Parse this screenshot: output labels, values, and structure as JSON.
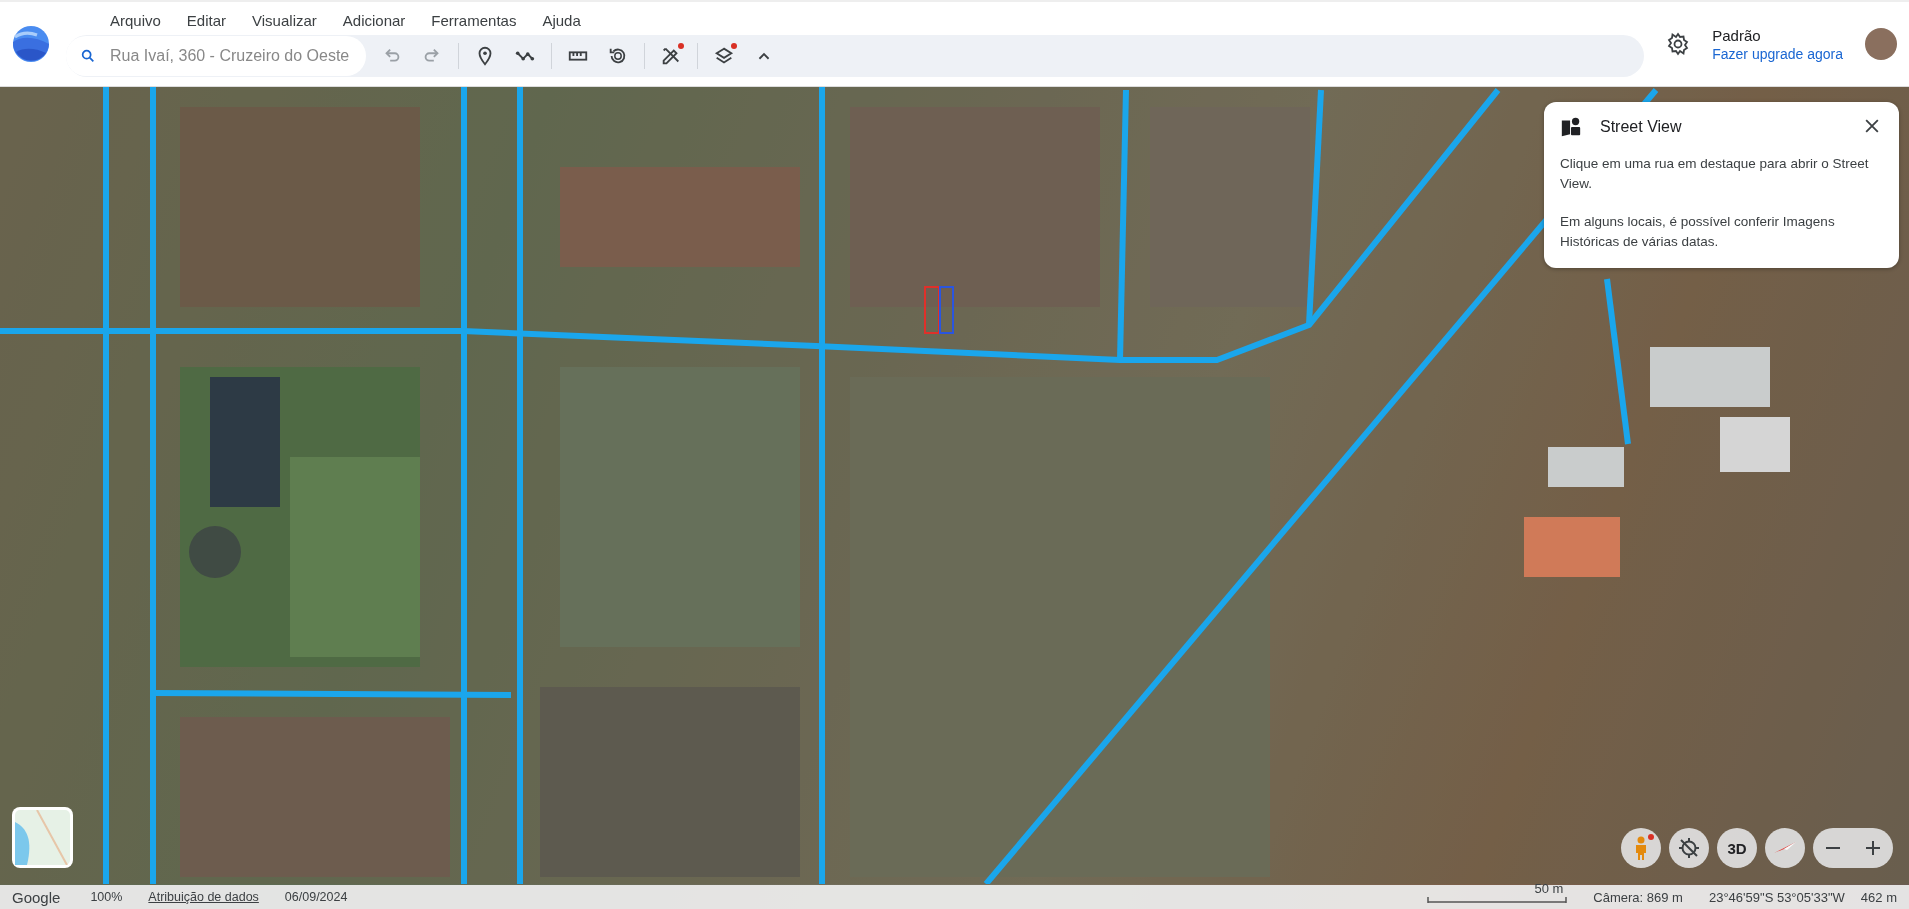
{
  "menu": [
    "Arquivo",
    "Editar",
    "Visualizar",
    "Adicionar",
    "Ferramentas",
    "Ajuda"
  ],
  "search": {
    "placeholder": "Rua Ivaí, 360 - Cruzeiro do Oeste"
  },
  "toolbar_groups": [
    [
      {
        "kind": "undo",
        "disabled": true
      },
      {
        "kind": "redo",
        "disabled": true
      }
    ],
    [
      {
        "kind": "pin",
        "disabled": false
      },
      {
        "kind": "path",
        "disabled": false
      }
    ],
    [
      {
        "kind": "ruler",
        "disabled": false
      },
      {
        "kind": "history",
        "disabled": false
      }
    ],
    [
      {
        "kind": "tools",
        "disabled": false,
        "badge": true
      }
    ],
    [
      {
        "kind": "layers",
        "disabled": false,
        "badge": true
      },
      {
        "kind": "collapse",
        "disabled": false
      }
    ]
  ],
  "account": {
    "plan": "Padrão",
    "upgrade_link": "Fazer upgrade agora"
  },
  "street_view_panel": {
    "title": "Street View",
    "paragraphs": [
      "Clique em uma rua em destaque para abrir o Street View.",
      "Em alguns locais, é possível conferir Imagens Históricas de várias datas."
    ]
  },
  "map_controls": [
    {
      "kind": "pegman",
      "badge": true
    },
    {
      "kind": "locate"
    },
    {
      "kind": "label",
      "label": "3D"
    },
    {
      "kind": "compass"
    },
    {
      "kind": "zoom"
    }
  ],
  "status_bar": {
    "brand": "Google",
    "zoom": "100%",
    "attribution": "Atribuição de dados",
    "date": "06/09/2024",
    "scale": "50 m",
    "camera": "Câmera: 869 m",
    "coordinates": "23°46'59\"S 53°05'33\"W",
    "elevation": "462 m"
  }
}
